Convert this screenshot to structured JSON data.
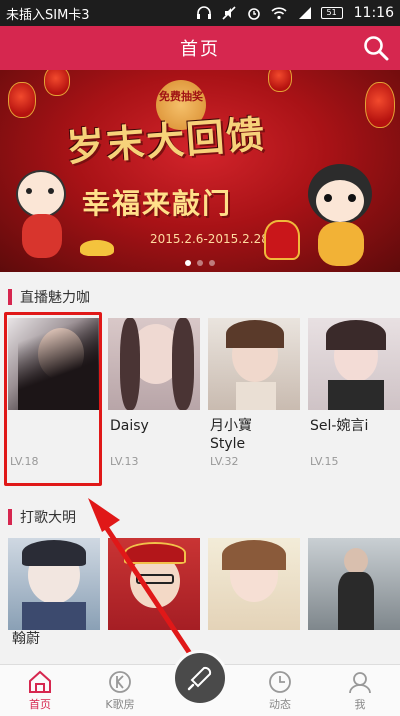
{
  "status_bar": {
    "carrier": "未插入SIM卡3",
    "battery": "51",
    "time": "11:16",
    "icons": [
      "headphones-icon",
      "mute-icon",
      "alarm-icon",
      "wifi-icon",
      "signal-icon",
      "battery-icon"
    ]
  },
  "header": {
    "title": "首页",
    "search_icon": "search-icon"
  },
  "banner": {
    "badge": "免费抽奖",
    "title": "岁末大回馈",
    "subtitle": "幸福来敲门",
    "date": "2015.2.6-2015.2.28",
    "slide_count": 3,
    "active_slide": 1
  },
  "section_live": {
    "title": "直播魅力咖",
    "cards": [
      {
        "name_line1": "",
        "name_line2": "",
        "level": "LV.18"
      },
      {
        "name_line1": "Daisy",
        "name_line2": "",
        "level": "LV.13"
      },
      {
        "name_line1": "月小寶",
        "name_line2": "Style",
        "level": "LV.32"
      },
      {
        "name_line1": "Sel-婉言i",
        "name_line2": "",
        "level": "LV.15"
      }
    ]
  },
  "section_singer": {
    "title": "打歌大明",
    "first_name": "翰蔚"
  },
  "bottom_nav": {
    "items": [
      {
        "label": "首页",
        "icon": "home-icon",
        "active": true
      },
      {
        "label": "K歌房",
        "icon": "k-room-icon",
        "active": false
      },
      {
        "label": "",
        "icon": "microphone-icon",
        "active": false
      },
      {
        "label": "动态",
        "icon": "clock-icon",
        "active": false
      },
      {
        "label": "我",
        "icon": "user-icon",
        "active": false
      }
    ]
  },
  "colors": {
    "accent": "#d6274f",
    "highlight": "#e01818"
  }
}
